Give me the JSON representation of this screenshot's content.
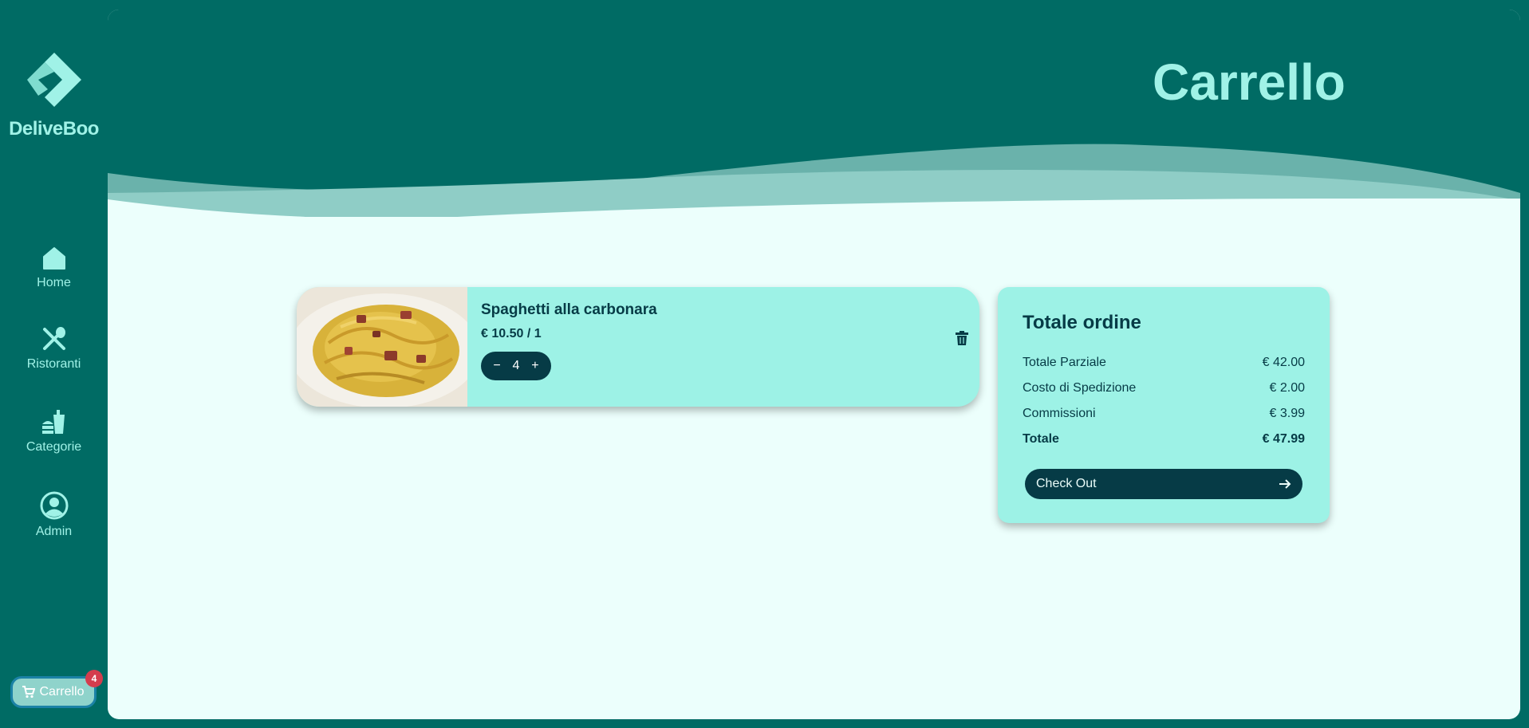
{
  "brand": {
    "name": "DeliveBoo",
    "logo_icon": "diamond-chevron-logo"
  },
  "nav": [
    {
      "label": "Home",
      "icon": "home-icon"
    },
    {
      "label": "Ristoranti",
      "icon": "fork-spoon-icon"
    },
    {
      "label": "Categorie",
      "icon": "food-category-icon"
    },
    {
      "label": "Admin",
      "icon": "user-circle-icon"
    }
  ],
  "cart_button": {
    "label": "Carrello",
    "badge": "4",
    "icon": "shopping-cart-icon"
  },
  "page": {
    "title": "Carrello"
  },
  "cart_item": {
    "name": "Spaghetti alla carbonara",
    "price": "€ 10.50 / 1",
    "quantity": "4",
    "minus": "−",
    "plus": "+",
    "image": "carbonara-photo"
  },
  "summary": {
    "title": "Totale ordine",
    "rows": [
      {
        "label": "Totale Parziale",
        "value": "€ 42.00"
      },
      {
        "label": "Costo di Spedizione",
        "value": "€ 2.00"
      },
      {
        "label": "Commissioni",
        "value": "€ 3.99"
      },
      {
        "label": "Totale",
        "value": "€ 47.99"
      }
    ],
    "checkout_label": "Check Out",
    "checkout_icon": "arrow-right-icon"
  },
  "colors": {
    "sidebar_bg": "#006b64",
    "accent_light": "#a0f2e7",
    "card_bg": "#9df2e6",
    "dark": "#063b46",
    "page_bg": "#ecfffc",
    "badge": "#d43d4e"
  }
}
